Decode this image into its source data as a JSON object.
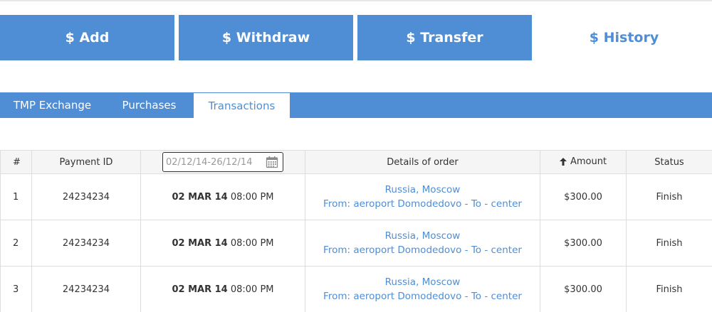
{
  "main_tabs": [
    {
      "label": "$ Add"
    },
    {
      "label": "$ Withdraw"
    },
    {
      "label": "$ Transfer"
    },
    {
      "label": "$ History"
    }
  ],
  "sub_tabs": [
    {
      "label": "TMP Exchange"
    },
    {
      "label": "Purchases"
    },
    {
      "label": "Transactions"
    }
  ],
  "table": {
    "headers": {
      "num": "#",
      "payment_id": "Payment ID",
      "date_range": "02/12/14-26/12/14",
      "details": "Details of order",
      "amount": "Amount",
      "status": "Status"
    },
    "rows": [
      {
        "num": "1",
        "payment_id": "24234234",
        "date": "02 MAR 14",
        "time": "08:00 PM",
        "location": "Russia, Moscow",
        "route": "From: aeroport Domodedovo - To - center",
        "amount": "$300.00",
        "status": "Finish"
      },
      {
        "num": "2",
        "payment_id": "24234234",
        "date": "02 MAR 14",
        "time": "08:00 PM",
        "location": "Russia, Moscow",
        "route": "From: aeroport Domodedovo - To - center",
        "amount": "$300.00",
        "status": "Finish"
      },
      {
        "num": "3",
        "payment_id": "24234234",
        "date": "02 MAR 14",
        "time": "08:00 PM",
        "location": "Russia, Moscow",
        "route": "From: aeroport Domodedovo - To - center",
        "amount": "$300.00",
        "status": "Finish"
      }
    ]
  },
  "colors": {
    "accent": "#4f8ed4",
    "header_bg": "#f5f5f5",
    "border": "#dddddd"
  },
  "icons": {
    "date_picker": "calendar-icon",
    "sort": "arrow-up-icon"
  }
}
